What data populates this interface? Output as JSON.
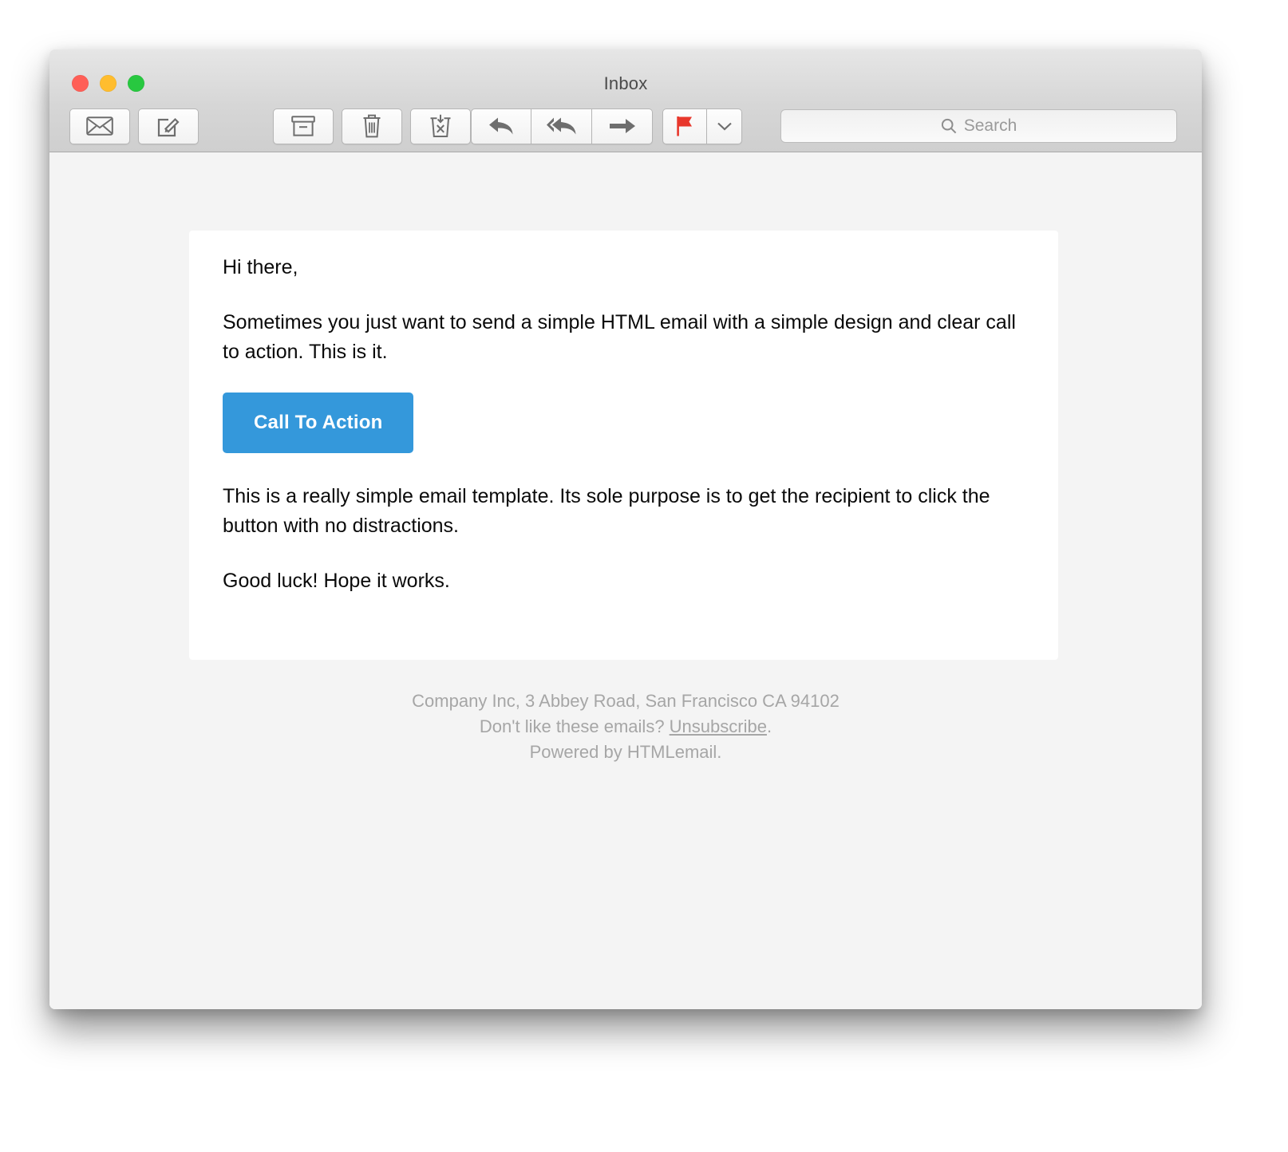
{
  "window": {
    "title": "Inbox",
    "traffic_lights": [
      {
        "name": "close",
        "color": "#ff5f57"
      },
      {
        "name": "minimize",
        "color": "#ffbd2e"
      },
      {
        "name": "zoom",
        "color": "#28c840"
      }
    ]
  },
  "toolbar": {
    "buttons": [
      {
        "name": "get-mail",
        "icon": "envelope-icon"
      },
      {
        "name": "compose",
        "icon": "compose-icon"
      },
      {
        "name": "archive",
        "icon": "archive-icon"
      },
      {
        "name": "delete",
        "icon": "trash-icon"
      },
      {
        "name": "junk",
        "icon": "junk-icon"
      },
      {
        "name": "reply",
        "icon": "reply-icon"
      },
      {
        "name": "reply-all",
        "icon": "reply-all-icon"
      },
      {
        "name": "forward",
        "icon": "forward-arrow-icon"
      },
      {
        "name": "flag",
        "icon": "flag-icon"
      },
      {
        "name": "flag-menu",
        "icon": "chevron-down-icon"
      }
    ],
    "flag_color": "#e8372c"
  },
  "search": {
    "placeholder": "Search",
    "value": "",
    "icon": "search-icon"
  },
  "email": {
    "greeting": "Hi there,",
    "paragraph_1": "Sometimes you just want to send a simple HTML email with a simple design and clear call to action. This is it.",
    "cta_label": "Call To Action",
    "cta_color": "#3498db",
    "paragraph_2": "This is a really simple email template. Its sole purpose is to get the recipient to click the button with no distractions.",
    "paragraph_3": "Good luck! Hope it works."
  },
  "footer": {
    "address": "Company Inc, 3 Abbey Road, San Francisco CA 94102",
    "unsubscribe_prefix": "Don't like these emails? ",
    "unsubscribe_link": "Unsubscribe",
    "unsubscribe_suffix": ".",
    "powered_by": "Powered by HTMLemail."
  }
}
